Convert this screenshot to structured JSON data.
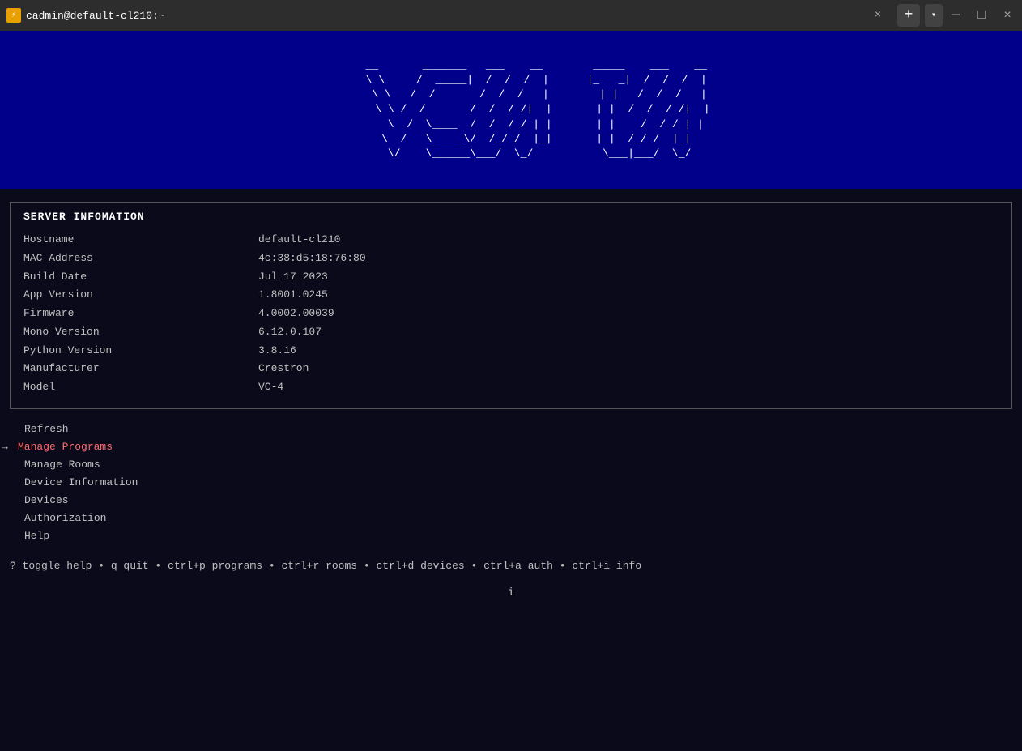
{
  "titlebar": {
    "tab_label": "cadmin@default-cl210:~",
    "tab_icon": "⚡",
    "close_label": "×",
    "new_tab_label": "+",
    "dropdown_label": "▾",
    "minimize_label": "─",
    "maximize_label": "□",
    "window_close_label": "×"
  },
  "banner": {
    "ascii_art": "   __    _______  ___  __     _____  ___  __\n   \\ \\  /  _____|/  / /  |   |_   _|/  / /  |\n    \\ \\/  /      /  / /   |    | | /  / /   |\n     \\   /      /  / / /|  |   | |/  / / /|  |\n      \\ /      /  / / / | |   | |   / / / | |\n   \\  / \\____/  /_/ /  |_|   |_| /_/ /  |_|\n    \\/   \\_____\\___/   \\_/   \\___|___/   \\_/"
  },
  "server_info": {
    "title": "SERVER INFOMATION",
    "rows": [
      {
        "label": "Hostname",
        "value": "default-cl210"
      },
      {
        "label": "MAC Address",
        "value": "4c:38:d5:18:76:80"
      },
      {
        "label": "Build Date",
        "value": "Jul 17 2023"
      },
      {
        "label": "App Version",
        "value": "1.8001.0245"
      },
      {
        "label": "Firmware",
        "value": "4.0002.00039"
      },
      {
        "label": "Mono Version",
        "value": "6.12.0.107"
      },
      {
        "label": "Python Version",
        "value": "3.8.16"
      },
      {
        "label": "Manufacturer",
        "value": "Crestron"
      },
      {
        "label": "Model",
        "value": "VC-4"
      }
    ]
  },
  "menu": {
    "items": [
      {
        "label": "Refresh",
        "active": false,
        "arrow": false
      },
      {
        "label": "Manage Programs",
        "active": true,
        "arrow": true
      },
      {
        "label": "Manage Rooms",
        "active": false,
        "arrow": false
      },
      {
        "label": "Device Information",
        "active": false,
        "arrow": false
      },
      {
        "label": "Devices",
        "active": false,
        "arrow": false
      },
      {
        "label": "Authorization",
        "active": false,
        "arrow": false
      },
      {
        "label": "Help",
        "active": false,
        "arrow": false
      }
    ]
  },
  "help_bar": {
    "text": "? toggle help • q quit • ctrl+p programs • ctrl+r rooms • ctrl+d devices • ctrl+a auth • ctrl+i info"
  }
}
